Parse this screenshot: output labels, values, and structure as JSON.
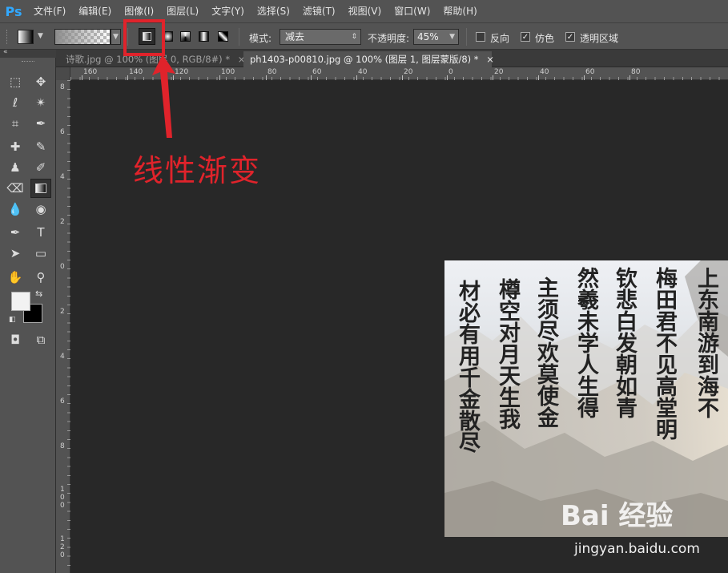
{
  "app": {
    "logo": "Ps"
  },
  "menu": [
    "文件(F)",
    "编辑(E)",
    "图像(I)",
    "图层(L)",
    "文字(Y)",
    "选择(S)",
    "滤镜(T)",
    "视图(V)",
    "窗口(W)",
    "帮助(H)"
  ],
  "options": {
    "mode_label": "模式:",
    "mode_value": "减去",
    "opacity_label": "不透明度:",
    "opacity_value": "45%",
    "reverse_label": "反向",
    "reverse_checked": false,
    "dither_label": "仿色",
    "dither_checked": true,
    "transparency_label": "透明区域",
    "transparency_checked": true
  },
  "tabs": [
    {
      "label": "诗歌.jpg @ 100% (图层 0, RGB/8#) *",
      "close": "×",
      "active": false
    },
    {
      "label": "ph1403-p00810.jpg @ 100% (图层 1, 图层蒙版/8) *",
      "close": "×",
      "active": true
    }
  ],
  "ruler": {
    "h": [
      "160",
      "140",
      "120",
      "100",
      "80",
      "60",
      "40",
      "20",
      "0",
      "20",
      "40",
      "60",
      "80"
    ],
    "v": [
      "8",
      "6",
      "4",
      "2",
      "0",
      "2",
      "4",
      "6",
      "8",
      "1 0 0",
      "1 2 0"
    ]
  },
  "annotation": "线性渐变",
  "watermark": {
    "brand": "Bai 经验",
    "url": "jingyan.baidu.com"
  },
  "calligraphy": [
    "上东南游到海不",
    "梅田君不见高堂明",
    "钦悲白发朝如青",
    "然羲未学人生得",
    "主须尽欢莫使金",
    "樽空对月天生我",
    "材必有用千金散尽"
  ],
  "colors": {
    "accent": "#31a8ff",
    "highlight": "#e0232b",
    "panel": "#535353",
    "canvas": "#282828"
  }
}
